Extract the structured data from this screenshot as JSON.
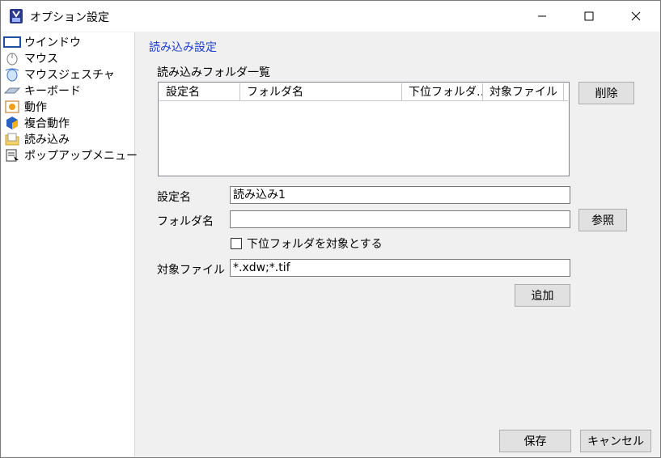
{
  "window": {
    "title": "オプション設定",
    "app_icon": "app-icon",
    "controls": [
      "minimize-icon",
      "maximize-icon",
      "close-icon"
    ]
  },
  "sidebar": {
    "items": [
      {
        "label": "ウインドウ",
        "icon": "window-icon"
      },
      {
        "label": "マウス",
        "icon": "mouse-icon"
      },
      {
        "label": "マウスジェスチャ",
        "icon": "mouse-gesture-icon"
      },
      {
        "label": "キーボード",
        "icon": "keyboard-icon"
      },
      {
        "label": "動作",
        "icon": "action-icon"
      },
      {
        "label": "複合動作",
        "icon": "compound-action-icon"
      },
      {
        "label": "読み込み",
        "icon": "folder-load-icon"
      },
      {
        "label": "ポップアップメニュー",
        "icon": "popup-menu-icon"
      }
    ],
    "selected_index": 6
  },
  "main": {
    "section_title": "読み込み設定",
    "list_title": "読み込みフォルダ一覧",
    "list_columns": [
      "設定名",
      "フォルダ名",
      "下位フォルダ…",
      "対象ファイル"
    ],
    "list_rows": [],
    "delete_button": "削除",
    "setting_name_label": "設定名",
    "setting_name_value": "読み込み1",
    "folder_label": "フォルダ名",
    "folder_value": "",
    "browse_button": "参照",
    "subfolder_checkbox_label": "下位フォルダを対象とする",
    "subfolder_checked": false,
    "target_file_label": "対象ファイル",
    "target_file_value": "*.xdw;*.tif",
    "add_button": "追加"
  },
  "footer": {
    "save_button": "保存",
    "cancel_button": "キャンセル"
  },
  "colors": {
    "section_title": "#1e3fd0",
    "window_bg": "#f0f0f0",
    "button_bg": "#e1e1e1"
  }
}
